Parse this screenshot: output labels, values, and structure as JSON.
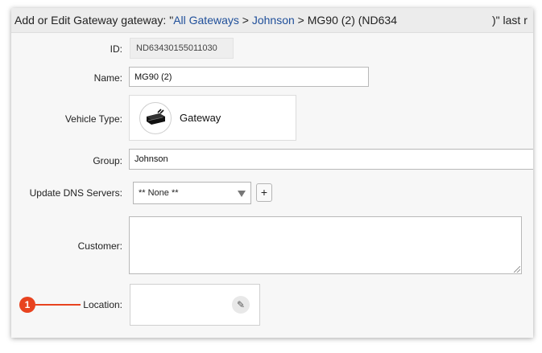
{
  "title": {
    "prefix": "Add or Edit Gateway gateway: \"",
    "crumb1": "All Gateways",
    "sep1": " > ",
    "crumb2": "Johnson",
    "rest": " > MG90 (2) (ND634",
    "tail": ")\" last r"
  },
  "form": {
    "id_label": "ID:",
    "id_value": "ND63430155011030",
    "name_label": "Name:",
    "name_value": "MG90 (2)",
    "vehicle_label": "Vehicle Type:",
    "vehicle_value": "Gateway",
    "group_label": "Group:",
    "group_value": "Johnson",
    "dns_label": "Update DNS Servers:",
    "dns_selected": "** None **",
    "add_label": "+",
    "customer_label": "Customer:",
    "location_label": "Location:"
  },
  "callout": {
    "number": "1",
    "color": "#e8431f"
  },
  "icons": {
    "vehicle": "gateway-device-icon",
    "location_edit": "pencil-icon"
  }
}
